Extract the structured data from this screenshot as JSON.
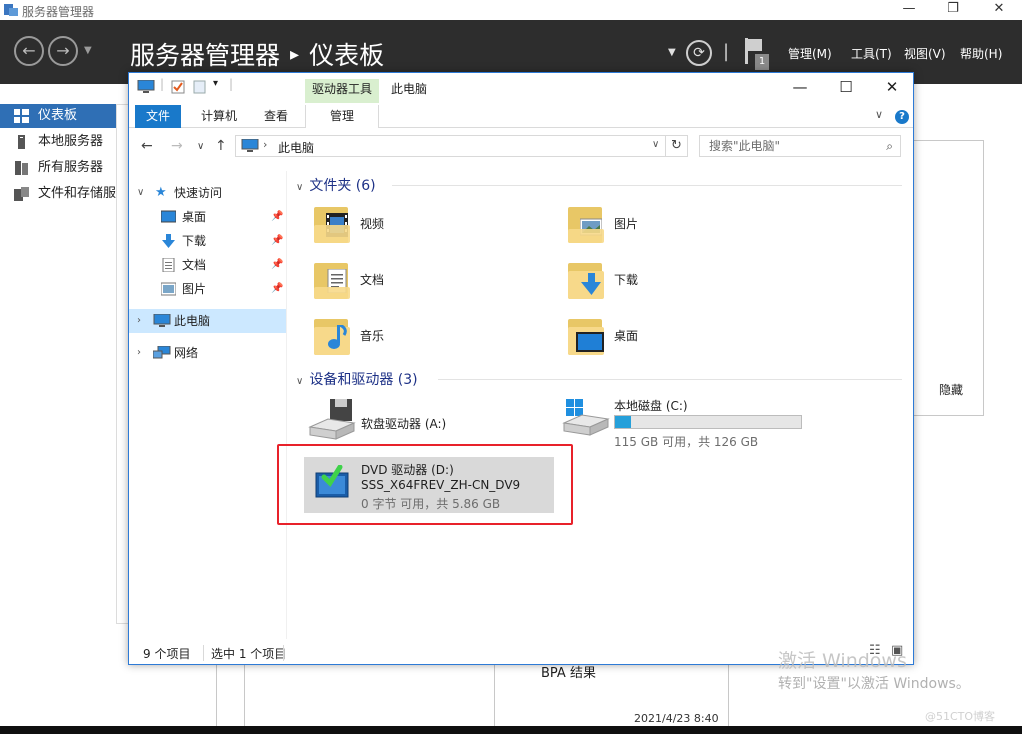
{
  "server_manager": {
    "window_title": "服务器管理器",
    "breadcrumb_app": "服务器管理器",
    "breadcrumb_separator": "▸",
    "breadcrumb_page": "仪表板",
    "notification_count": "1",
    "menus": [
      "管理(M)",
      "工具(T)",
      "视图(V)",
      "帮助(H)"
    ],
    "sidebar": [
      {
        "label": "仪表板",
        "active": true
      },
      {
        "label": "本地服务器"
      },
      {
        "label": "所有服务器"
      },
      {
        "label": "文件和存储服"
      }
    ],
    "hide_label": "隐藏",
    "bpa_label": "BPA 结果",
    "timestamp": "2021/4/23 8:40"
  },
  "explorer": {
    "contextual_tab_group": "驱动器工具",
    "title": "此电脑",
    "tabs": {
      "file": "文件",
      "computer": "计算机",
      "view": "查看",
      "manage": "管理"
    },
    "address": {
      "crumb": "此电脑"
    },
    "search": {
      "placeholder": "搜索\"此电脑\""
    },
    "nav_pane": {
      "quick_access": "快速访问",
      "quick_items": [
        {
          "label": "桌面",
          "icon": "desktop-icon"
        },
        {
          "label": "下载",
          "icon": "download-icon"
        },
        {
          "label": "文档",
          "icon": "documents-icon"
        },
        {
          "label": "图片",
          "icon": "pictures-icon"
        }
      ],
      "this_pc": "此电脑",
      "network": "网络"
    },
    "folders_header": "文件夹 (6)",
    "folders": [
      {
        "label": "视频",
        "icon": "videos-folder-icon"
      },
      {
        "label": "图片",
        "icon": "pictures-folder-icon"
      },
      {
        "label": "文档",
        "icon": "documents-folder-icon"
      },
      {
        "label": "下载",
        "icon": "downloads-folder-icon"
      },
      {
        "label": "音乐",
        "icon": "music-folder-icon"
      },
      {
        "label": "桌面",
        "icon": "desktop-folder-icon"
      }
    ],
    "devices_header": "设备和驱动器 (3)",
    "drives": {
      "floppy": {
        "label": "软盘驱动器 (A:)"
      },
      "local_c": {
        "label": "本地磁盘 (C:)",
        "free": "115 GB 可用，共 126 GB",
        "used_fraction": 0.087
      },
      "dvd": {
        "label": "DVD 驱动器 (D:)",
        "volume": "SSS_X64FREV_ZH-CN_DV9",
        "free": "0 字节 可用，共 5.86 GB"
      }
    },
    "status": {
      "count": "9 个项目",
      "selected": "选中 1 个项目"
    }
  },
  "watermark": {
    "line1": "激活 Windows",
    "line2": "转到\"设置\"以激活 Windows。",
    "site": "@51CTO博客"
  },
  "colors": {
    "accent": "#1979ca",
    "highlight": "#e8212a",
    "selection": "#cce8ff",
    "header_bg": "#2d2d2d"
  }
}
